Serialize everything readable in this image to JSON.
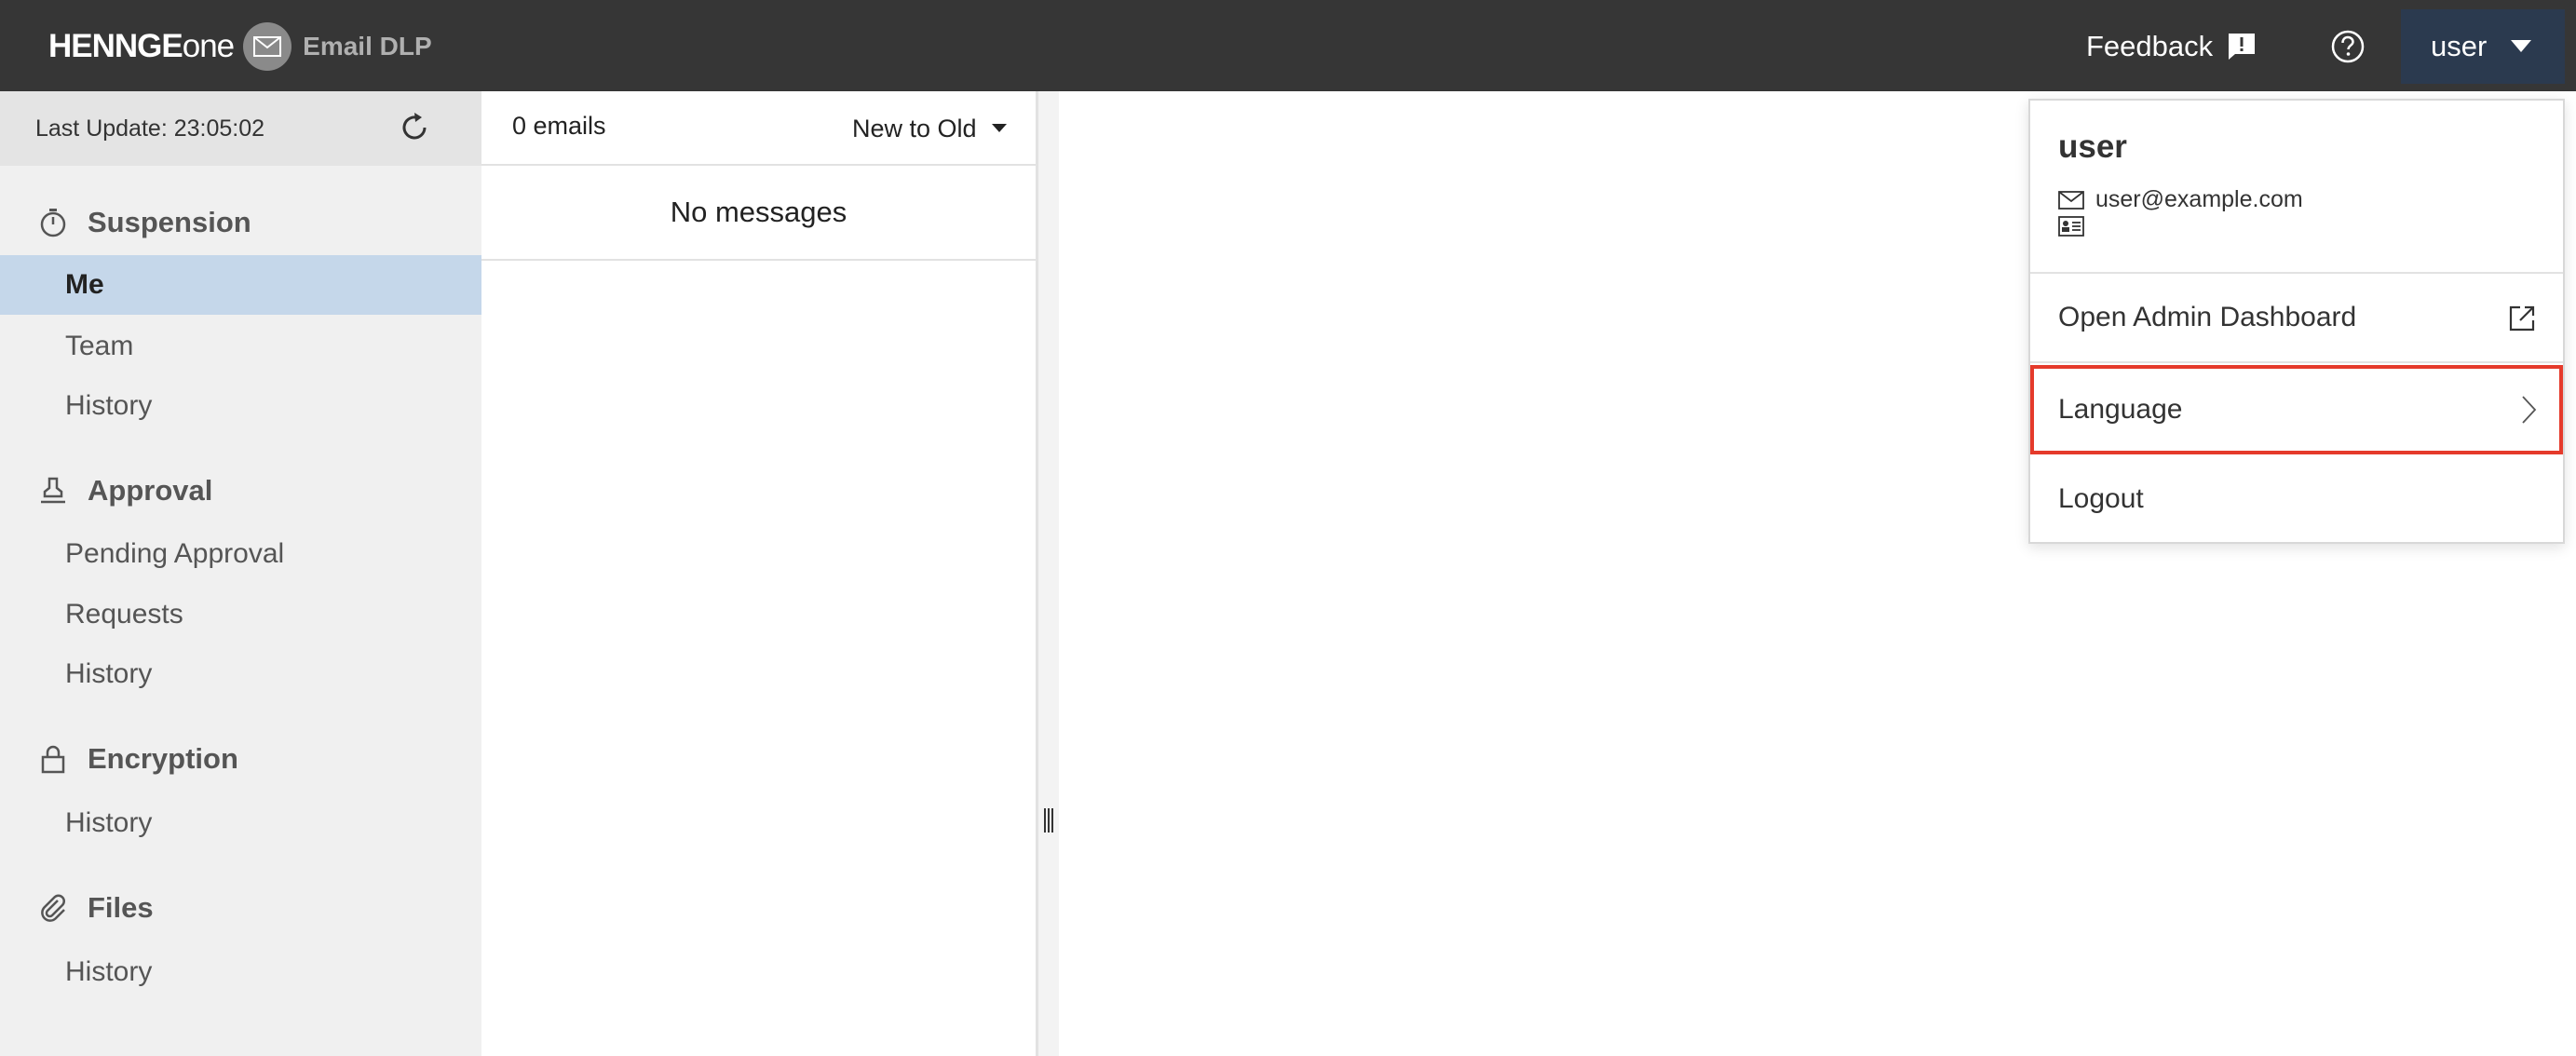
{
  "header": {
    "brand_name": "HENNGE",
    "brand_one": "one",
    "product": "Email DLP",
    "feedback_label": "Feedback",
    "user_label": "user"
  },
  "sidebar": {
    "last_update": "Last Update: 23:05:02",
    "sections": {
      "suspension": {
        "title": "Suspension",
        "items": [
          "Me",
          "Team",
          "History"
        ]
      },
      "approval": {
        "title": "Approval",
        "items": [
          "Pending Approval",
          "Requests",
          "History"
        ]
      },
      "encryption": {
        "title": "Encryption",
        "items": [
          "History"
        ]
      },
      "files": {
        "title": "Files",
        "items": [
          "History"
        ]
      }
    },
    "active_item": "Me"
  },
  "list": {
    "count": "0 emails",
    "sort": "New to Old",
    "empty_text": "No messages"
  },
  "user_menu": {
    "name": "user",
    "email": "user@example.com",
    "items": [
      "Open Admin Dashboard",
      "Language",
      "Logout"
    ],
    "highlighted_item": "Language",
    "highlight_color": "#e53a2b"
  },
  "colors": {
    "topbar": "#363636",
    "user_button": "#2b3a4f",
    "active_nav": "#c5d7ea"
  }
}
